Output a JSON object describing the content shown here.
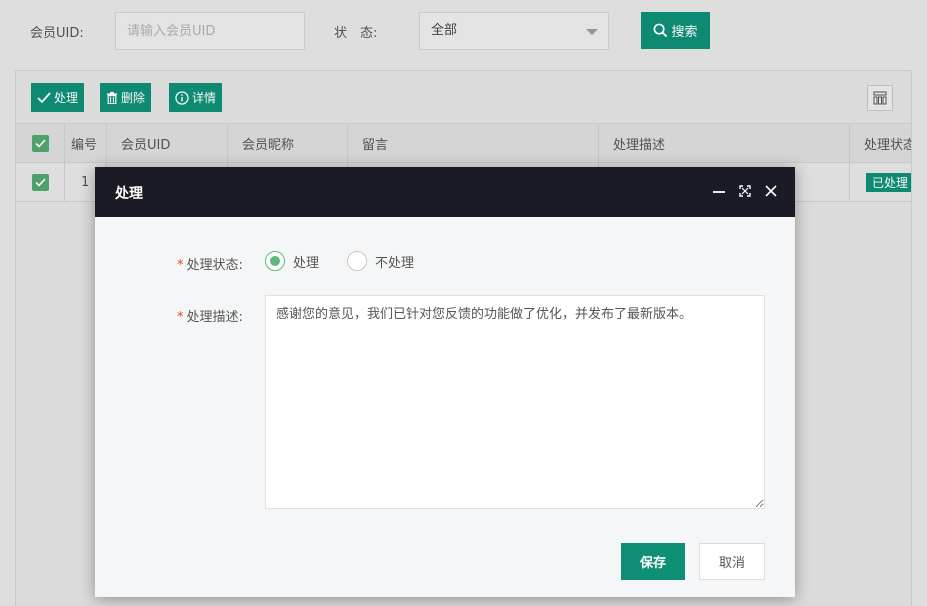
{
  "search": {
    "uid_label": "会员UID:",
    "uid_placeholder": "请输入会员UID",
    "status_label": "状　态:",
    "status_value": "全部",
    "search_button": "搜索"
  },
  "toolbar": {
    "process_label": "处理",
    "delete_label": "删除",
    "detail_label": "详情"
  },
  "table": {
    "headers": [
      "编号",
      "会员UID",
      "会员昵称",
      "留言",
      "处理描述",
      "处理状态"
    ],
    "rows": [
      {
        "no": "1",
        "status_badge": "已处理"
      }
    ]
  },
  "dialog": {
    "title": "处理",
    "status_label": "处理状态:",
    "status_options": [
      "处理",
      "不处理"
    ],
    "status_selected": "处理",
    "desc_label": "处理描述:",
    "desc_value": "感谢您的意见，我们已针对您反馈的功能做了优化，并发布了最新版本。",
    "save_label": "保存",
    "cancel_label": "取消"
  },
  "colors": {
    "primary": "#0f8f76",
    "checkbox": "#52a66f",
    "dialog_header": "#1a1b24",
    "required": "#e2452b"
  }
}
